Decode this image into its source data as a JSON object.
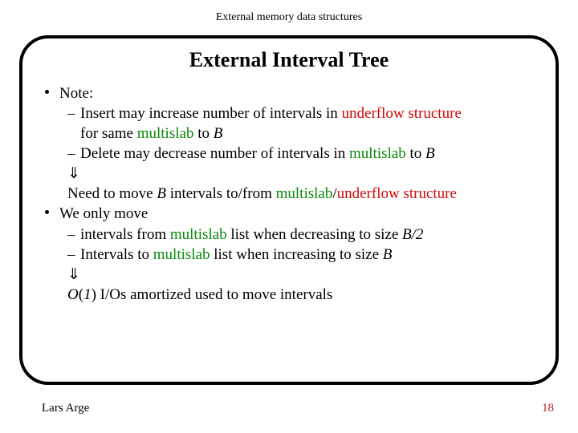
{
  "header": {
    "course": "External memory data structures"
  },
  "slide": {
    "title": "External Interval Tree",
    "bullets": {
      "note_label": "Note:",
      "line1_a": "Insert may increase number of intervals in ",
      "line1_us": "underflow structure",
      "line1_cont_a": "for same ",
      "line1_ms": "multislab",
      "line1_cont_b": " to ",
      "line1_B": "B",
      "line2_a": "Delete may decrease number of intervals in ",
      "line2_ms": "multislab",
      "line2_b": " to ",
      "line2_B": "B",
      "arrow1": "⇓",
      "line3_a": "Need to move ",
      "line3_B": "B",
      "line3_b": " intervals to/from ",
      "line3_ms": "multislab",
      "line3_slash": "/",
      "line3_us": "underflow structure",
      "we_only": "We only move",
      "line4_a": "intervals from ",
      "line4_ms": "multislab",
      "line4_b": " list when decreasing to size ",
      "line4_B2": "B/2",
      "line5_a": "Intervals to ",
      "line5_ms": "multislab",
      "line5_b": " list when increasing to size ",
      "line5_B": "B",
      "arrow2": "⇓",
      "line6_O": "O",
      "line6_paren": "(",
      "line6_one": "1",
      "line6_paren2": ")",
      "line6_rest": " I/Os amortized used to move intervals"
    }
  },
  "footer": {
    "author": "Lars Arge",
    "page": "18"
  }
}
